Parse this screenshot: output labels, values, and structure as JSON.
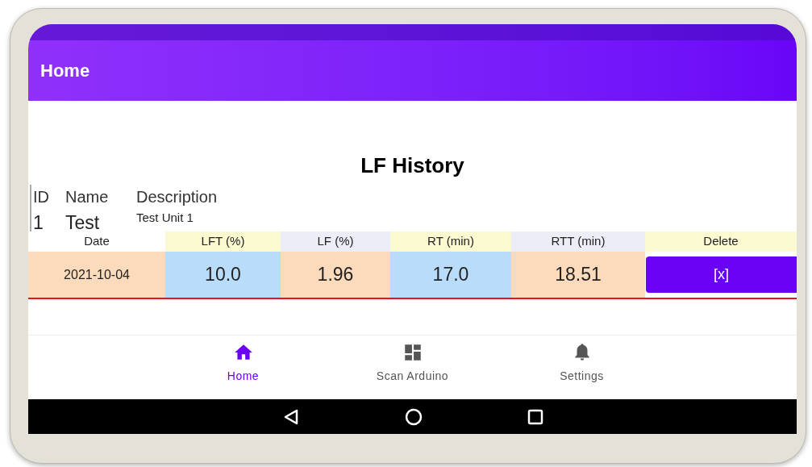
{
  "app_bar": {
    "title": "Home"
  },
  "heading": "LF History",
  "unit": {
    "columns": [
      "ID",
      "Name",
      "Description"
    ],
    "values": [
      "1",
      "Test",
      "Test Unit 1"
    ]
  },
  "table": {
    "columns": [
      "Date",
      "LFT (%)",
      "LF (%)",
      "RT (min)",
      "RTT (min)",
      "Delete"
    ],
    "rows": [
      {
        "cells": [
          "2021-10-04",
          "10.0",
          "1.96",
          "17.0",
          "18.51"
        ],
        "delete": "[x]"
      }
    ]
  },
  "bottom_nav": [
    {
      "kind": "home",
      "label": "Home",
      "selected": true
    },
    {
      "kind": "dashboard",
      "label": "Scan Arduino",
      "selected": false
    },
    {
      "kind": "bell",
      "label": "Settings",
      "selected": false
    }
  ]
}
